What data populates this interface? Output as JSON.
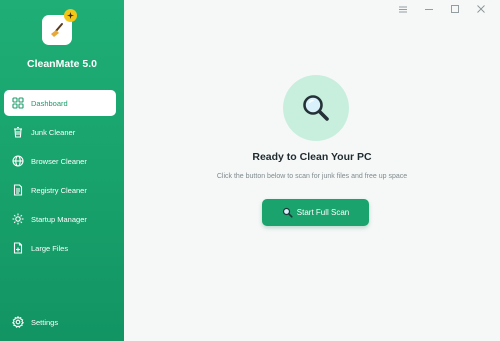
{
  "app": {
    "name": "CleanMate 5.0"
  },
  "colors": {
    "sidebar": "#1aa36c",
    "accent": "#1aa36c",
    "hero_bg": "#c8efdd",
    "badge": "#f5c518"
  },
  "sidebar": {
    "items": [
      {
        "label": "Dashboard",
        "icon": "grid-icon",
        "active": true
      },
      {
        "label": "Junk Cleaner",
        "icon": "trash-icon",
        "active": false
      },
      {
        "label": "Browser Cleaner",
        "icon": "globe-icon",
        "active": false
      },
      {
        "label": "Registry Cleaner",
        "icon": "document-icon",
        "active": false
      },
      {
        "label": "Startup Manager",
        "icon": "sun-icon",
        "active": false
      },
      {
        "label": "Large Files",
        "icon": "file-icon",
        "active": false
      }
    ],
    "settings_label": "Settings"
  },
  "window_controls": [
    "menu-icon",
    "minimize-icon",
    "maximize-icon",
    "close-icon"
  ],
  "main": {
    "hero_icon": "magnifier-icon",
    "title": "Ready to Clean Your PC",
    "subtitle": "Click the button below to scan for junk files and free up space",
    "scan_button_label": "Start Full Scan",
    "scan_button_icon": "magnifier-icon"
  }
}
